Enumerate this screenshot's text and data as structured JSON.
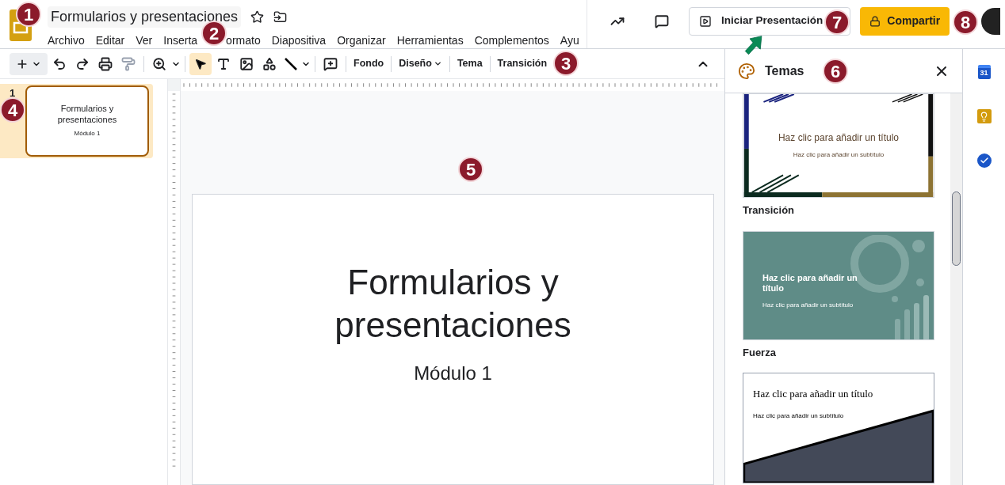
{
  "document": {
    "title": "Formularios y presentaciones"
  },
  "menu": [
    "Archivo",
    "Editar",
    "Ver",
    "Inserta",
    "ormato",
    "Diapositiva",
    "Organizar",
    "Herramientas",
    "Complementos",
    "Ayu"
  ],
  "header_buttons": {
    "present": "Iniciar Presentación",
    "share": "Compartir"
  },
  "toolbar": {
    "text_buttons": [
      {
        "label": "Fondo",
        "dropdown": false
      },
      {
        "label": "Diseño",
        "dropdown": true
      },
      {
        "label": "Tema",
        "dropdown": false
      },
      {
        "label": "Transición",
        "dropdown": false
      }
    ],
    "select_tool_selected": true
  },
  "filmstrip": [
    {
      "number": "1",
      "title": "Formularios y presentaciones",
      "subtitle": "Módulo 1",
      "selected": true
    }
  ],
  "slide": {
    "title": "Formularios y presentaciones",
    "subtitle": "Módulo 1"
  },
  "themes_panel": {
    "title": "Temas",
    "themes": [
      {
        "kind": "stripes",
        "title": "Haz clic para añadir un título",
        "subtitle": "Haz clic para añadir un subtítulo",
        "name": "Transición"
      },
      {
        "kind": "teal",
        "title": "Haz clic para añadir un título",
        "subtitle": "Haz clic para añadir un subtítulo",
        "name": "Fuerza"
      },
      {
        "kind": "diagonal",
        "title": "Haz clic para añadir un título",
        "subtitle": "Haz clic para añadir un subtítulo"
      }
    ]
  },
  "side_apps": {
    "calendar_day": "31"
  },
  "callouts": [
    "1",
    "2",
    "3",
    "4",
    "5",
    "6",
    "7",
    "8"
  ]
}
